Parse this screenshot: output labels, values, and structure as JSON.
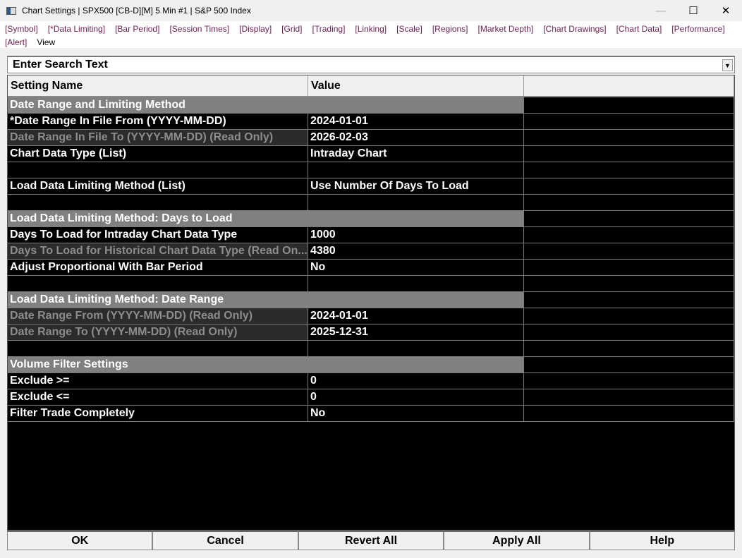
{
  "window": {
    "title": "Chart Settings | SPX500 [CB-D][M]  5 Min  #1 | S&P 500 Index",
    "minimize": "—",
    "maximize": "☐",
    "close": "✕"
  },
  "menu": [
    "[Symbol]",
    "[*Data Limiting]",
    "[Bar Period]",
    "[Session Times]",
    "[Display]",
    "[Grid]",
    "[Trading]",
    "[Linking]",
    "[Scale]",
    "[Regions]",
    "[Market Depth]",
    "[Chart Drawings]",
    "[Chart Data]",
    "[Performance]",
    "[Alert]",
    "View"
  ],
  "search": {
    "placeholder": "Enter Search Text",
    "dropdown_icon": "▼"
  },
  "table": {
    "headers": [
      "Setting Name",
      "Value",
      ""
    ],
    "rows": [
      {
        "type": "section",
        "name": "Date Range and Limiting Method",
        "value": ""
      },
      {
        "type": "normal",
        "name": "*Date Range In File From (YYYY-MM-DD)",
        "value": "2024-01-01"
      },
      {
        "type": "ro",
        "name": "Date Range In File To (YYYY-MM-DD) (Read Only)",
        "value": "2026-02-03"
      },
      {
        "type": "normal",
        "name": "Chart Data Type (List)",
        "value": "Intraday Chart"
      },
      {
        "type": "empty",
        "name": "",
        "value": ""
      },
      {
        "type": "normal",
        "name": "Load Data Limiting Method (List)",
        "value": "Use Number Of Days To Load"
      },
      {
        "type": "empty",
        "name": "",
        "value": ""
      },
      {
        "type": "section",
        "name": "Load Data Limiting Method: Days to Load",
        "value": ""
      },
      {
        "type": "normal",
        "name": "Days To Load for Intraday Chart Data Type",
        "value": "1000"
      },
      {
        "type": "ro",
        "name": "Days To Load for Historical Chart Data Type (Read On...",
        "value": "4380"
      },
      {
        "type": "normal",
        "name": "Adjust Proportional With Bar Period",
        "value": "No"
      },
      {
        "type": "empty",
        "name": "",
        "value": ""
      },
      {
        "type": "section",
        "name": "Load Data Limiting Method: Date Range",
        "value": ""
      },
      {
        "type": "ro",
        "name": "Date Range From (YYYY-MM-DD) (Read Only)",
        "value": "2024-01-01"
      },
      {
        "type": "ro",
        "name": "Date Range To (YYYY-MM-DD) (Read Only)",
        "value": "2025-12-31"
      },
      {
        "type": "empty",
        "name": "",
        "value": ""
      },
      {
        "type": "section",
        "name": "Volume Filter Settings",
        "value": ""
      },
      {
        "type": "normal",
        "name": "Exclude >=",
        "value": "0"
      },
      {
        "type": "normal",
        "name": "Exclude <=",
        "value": "0"
      },
      {
        "type": "normal",
        "name": "Filter Trade Completely",
        "value": "No"
      }
    ]
  },
  "buttons": [
    "OK",
    "Cancel",
    "Revert All",
    "Apply All",
    "Help"
  ]
}
